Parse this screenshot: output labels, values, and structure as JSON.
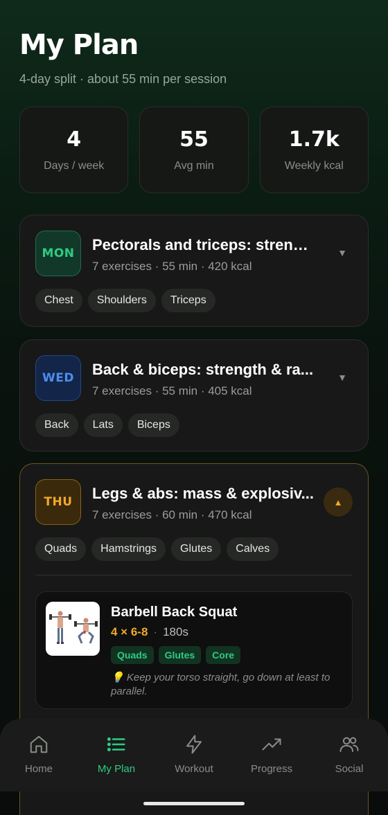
{
  "header": {
    "title": "My Plan",
    "subtitle": "4-day split · about 55 min per session"
  },
  "stats": [
    {
      "value": "4",
      "label": "Days / week"
    },
    {
      "value": "55",
      "label": "Avg min"
    },
    {
      "value": "1.7k",
      "label": "Weekly kcal"
    }
  ],
  "days": [
    {
      "day": "MON",
      "title": "Pectorals and triceps: streng...",
      "meta": "7 exercises · 55 min · 420 kcal",
      "tags": [
        "Chest",
        "Shoulders",
        "Triceps"
      ],
      "accent": "#2ecc83"
    },
    {
      "day": "WED",
      "title": "Back & biceps: strength & ra...",
      "meta": "7 exercises · 55 min · 405 kcal",
      "tags": [
        "Back",
        "Lats",
        "Biceps"
      ],
      "accent": "#4d8ef0"
    },
    {
      "day": "THU",
      "title": "Legs & abs: mass & explosiv...",
      "meta": "7 exercises · 60 min · 470 kcal",
      "tags": [
        "Quads",
        "Hamstrings",
        "Glutes",
        "Calves"
      ],
      "accent": "#f2a82a",
      "expanded": true,
      "exercises": [
        {
          "name": "Barbell Back Squat",
          "sets": "4 × 6-8",
          "separator": "·",
          "rest": "180s",
          "tags": [
            "Quads",
            "Glutes",
            "Core"
          ],
          "tip_icon": "lightbulb-icon",
          "tip": "💡 Keep your torso straight, go down at least to parallel."
        }
      ]
    }
  ],
  "nav": [
    {
      "label": "Home",
      "icon": "home-icon",
      "active": false
    },
    {
      "label": "My Plan",
      "icon": "list-icon",
      "active": true
    },
    {
      "label": "Workout",
      "icon": "lightning-icon",
      "active": false
    },
    {
      "label": "Progress",
      "icon": "trending-up-icon",
      "active": false
    },
    {
      "label": "Social",
      "icon": "users-icon",
      "active": false
    }
  ],
  "colors": {
    "active_green": "#2ecc83",
    "accent_amber": "#f2a82a",
    "accent_blue": "#4d8ef0"
  }
}
